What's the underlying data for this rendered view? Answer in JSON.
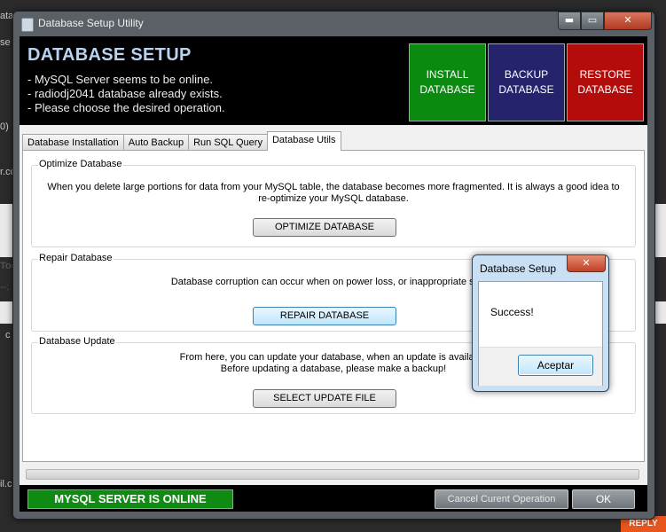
{
  "background": {
    "snippets": [
      "atab",
      "se",
      "0)",
      "r.cc",
      "Tod",
      "--;",
      "c",
      "il.c"
    ],
    "reply_label": "REPLY"
  },
  "window": {
    "title": "Database Setup Utility",
    "controls": {
      "minimize": "▬",
      "maximize": "▭",
      "close": "✕"
    }
  },
  "header": {
    "title": "DATABASE SETUP",
    "lines": [
      "- MySQL Server seems to be online.",
      "- radiodj2041 database already exists.",
      "- Please choose the desired operation."
    ],
    "buttons": {
      "install": "INSTALL\nDATABASE",
      "backup": "BACKUP\nDATABASE",
      "restore": "RESTORE\nDATABASE"
    },
    "colors": {
      "install": "#0b8a10",
      "backup": "#26236d",
      "restore": "#b40b0b"
    }
  },
  "tabs": [
    {
      "label": "Database Installation",
      "active": false
    },
    {
      "label": "Auto Backup",
      "active": false
    },
    {
      "label": "Run SQL Query",
      "active": false
    },
    {
      "label": "Database Utils",
      "active": true
    }
  ],
  "groups": {
    "optimize": {
      "label": "Optimize Database",
      "text1": "When you delete large portions for data from your MySQL table, the database becomes more fragmented. It is always a good idea to",
      "text2": "re-optimize your MySQL database.",
      "button": "OPTIMIZE DATABASE"
    },
    "repair": {
      "label": "Repair Database",
      "text1": "Database corruption can occur when on power loss, or inappropriate shut d",
      "button": "REPAIR DATABASE"
    },
    "update": {
      "label": "Database Update",
      "text1": "From here, you can update your database, when an update is available",
      "text2": "Before updating a database, please make a backup!",
      "button": "SELECT UPDATE FILE"
    }
  },
  "progress": {
    "value_percent": 0
  },
  "footer": {
    "status": "MYSQL SERVER IS ONLINE",
    "status_color": "#0f8a12",
    "cancel_button": "Cancel Curent Operation",
    "ok_button": "OK"
  },
  "dialog": {
    "title": "Database Setup",
    "close": "✕",
    "message": "Success!",
    "button": "Aceptar"
  }
}
